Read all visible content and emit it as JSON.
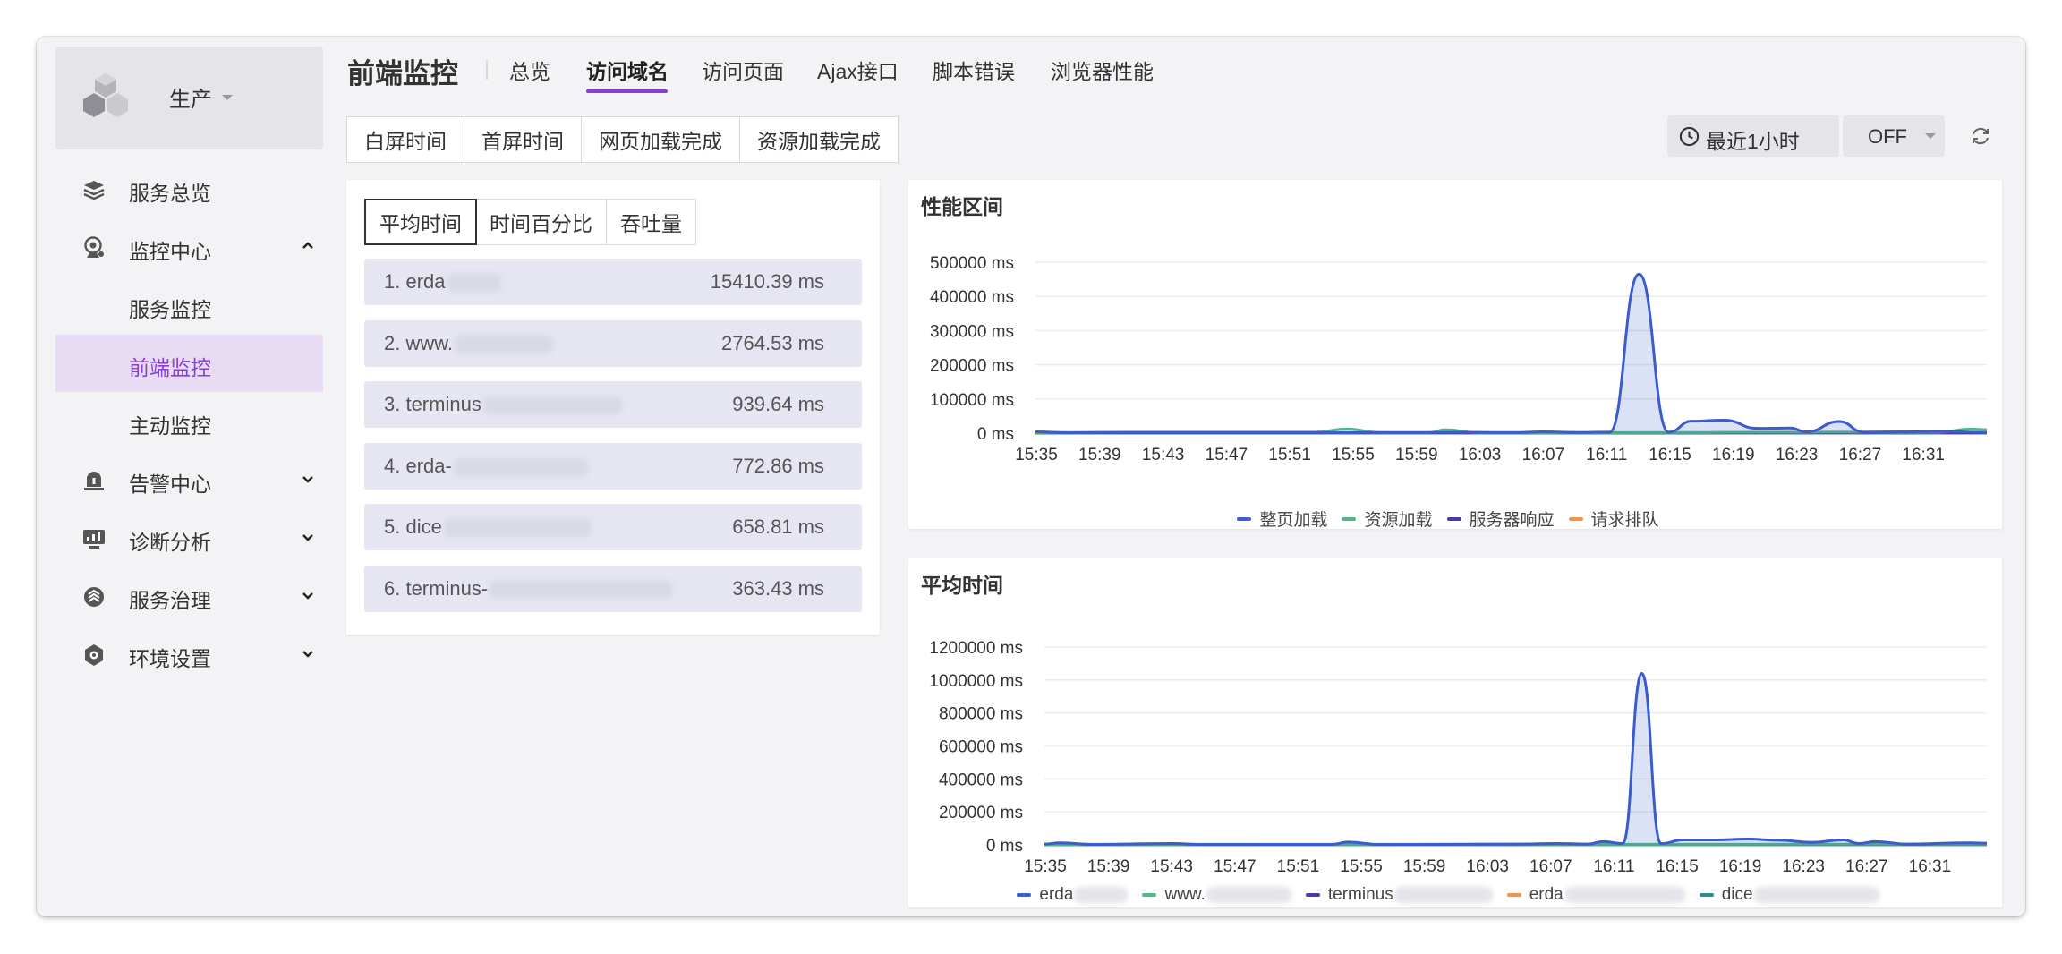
{
  "sidebar": {
    "env_label": "生产",
    "items": [
      {
        "label": "服务总览",
        "icon": "layers-icon"
      },
      {
        "label": "监控中心",
        "icon": "webcam-icon"
      },
      {
        "label": "服务监控"
      },
      {
        "label": "前端监控"
      },
      {
        "label": "主动监控"
      },
      {
        "label": "告警中心",
        "icon": "alarm-icon"
      },
      {
        "label": "诊断分析",
        "icon": "dashboard-icon"
      },
      {
        "label": "服务治理",
        "icon": "governance-icon"
      },
      {
        "label": "环境设置",
        "icon": "settings-icon"
      }
    ]
  },
  "header": {
    "title": "前端监控",
    "tabs": [
      "总览",
      "访问域名",
      "访问页面",
      "Ajax接口",
      "脚本错误",
      "浏览器性能"
    ],
    "active_tab": "访问域名"
  },
  "metric_tabs": [
    "白屏时间",
    "首屏时间",
    "网页加载完成",
    "资源加载完成"
  ],
  "time_range": "最近1小时",
  "refresh_mode": "OFF",
  "ranking": {
    "tabs": [
      "平均时间",
      "时间百分比",
      "吞吐量"
    ],
    "active_tab": "平均时间",
    "rows": [
      {
        "name": "1. erda",
        "value": "15410.39 ms"
      },
      {
        "name": "2. www.",
        "value": "2764.53 ms"
      },
      {
        "name": "3. terminus",
        "value": "939.64 ms"
      },
      {
        "name": "4. erda-",
        "value": "772.86 ms"
      },
      {
        "name": "5. dice",
        "value": "658.81 ms"
      },
      {
        "name": "6. terminus-",
        "value": "363.43 ms"
      }
    ]
  },
  "colors": {
    "accent": "#8a3ed6",
    "blue": "#3a5ccc",
    "green": "#52b788",
    "purple": "#4b3aa0",
    "orange": "#f0944a",
    "teal": "#2f8f8f"
  },
  "chart_data": [
    {
      "type": "area",
      "title": "性能区间",
      "x": [
        "15:35",
        "15:39",
        "15:43",
        "15:47",
        "15:51",
        "15:55",
        "15:59",
        "16:03",
        "16:07",
        "16:11",
        "16:15",
        "16:19",
        "16:23",
        "16:27",
        "16:31"
      ],
      "ytick_labels": [
        "500000 ms",
        "400000 ms",
        "300000 ms",
        "200000 ms",
        "100000 ms",
        "0 ms"
      ],
      "ylim": [
        0,
        500000
      ],
      "series": [
        {
          "name": "整页加载",
          "points": [
            [
              0,
              4000
            ],
            [
              2,
              1000
            ],
            [
              5,
              2000
            ],
            [
              8,
              1500
            ],
            [
              11,
              2000
            ],
            [
              14,
              1500
            ],
            [
              17,
              1500
            ],
            [
              20,
              2000
            ],
            [
              23,
              1500
            ],
            [
              26,
              2500
            ],
            [
              29,
              1500
            ],
            [
              31,
              4000
            ],
            [
              33,
              2000
            ],
            [
              35,
              3000
            ],
            [
              36.8,
              465000
            ],
            [
              38.6,
              3000
            ],
            [
              40,
              35000
            ],
            [
              42,
              38000
            ],
            [
              44,
              14000
            ],
            [
              46,
              15000
            ],
            [
              47,
              4000
            ],
            [
              49,
              34000
            ],
            [
              50.5,
              3000
            ],
            [
              53,
              4000
            ],
            [
              55,
              5000
            ],
            [
              58,
              2000
            ]
          ]
        },
        {
          "name": "资源加载",
          "points": [
            [
              0,
              1500
            ],
            [
              7,
              3000
            ],
            [
              17,
              3000
            ],
            [
              19,
              12000
            ],
            [
              21,
              2000
            ],
            [
              24,
              2000
            ],
            [
              25,
              10000
            ],
            [
              27,
              1500
            ],
            [
              40,
              2000
            ],
            [
              44,
              2500
            ],
            [
              50,
              3000
            ],
            [
              55,
              2500
            ],
            [
              57,
              12000
            ],
            [
              58,
              10000
            ]
          ]
        },
        {
          "name": "服务器响应",
          "points": [
            [
              0,
              300
            ],
            [
              58,
              300
            ]
          ]
        },
        {
          "name": "请求排队",
          "points": [
            [
              0,
              200
            ],
            [
              58,
              200
            ]
          ]
        }
      ]
    },
    {
      "type": "area",
      "title": "平均时间",
      "x": [
        "15:35",
        "15:39",
        "15:43",
        "15:47",
        "15:51",
        "15:55",
        "15:59",
        "16:03",
        "16:07",
        "16:11",
        "16:15",
        "16:19",
        "16:23",
        "16:27",
        "16:31"
      ],
      "ytick_labels": [
        "1200000 ms",
        "1000000 ms",
        "800000 ms",
        "600000 ms",
        "400000 ms",
        "200000 ms",
        "0 ms"
      ],
      "ylim": [
        0,
        1200000
      ],
      "series": [
        {
          "name": "erda",
          "points": [
            [
              0,
              5000
            ],
            [
              1,
              12000
            ],
            [
              3,
              3000
            ],
            [
              8,
              8000
            ],
            [
              10,
              2000
            ],
            [
              18,
              3000
            ],
            [
              19,
              17000
            ],
            [
              21,
              2000
            ],
            [
              30,
              5000
            ],
            [
              32,
              8000
            ],
            [
              34,
              5000
            ],
            [
              35,
              20000
            ],
            [
              36.2,
              8000
            ],
            [
              37.4,
              1040000
            ],
            [
              38.6,
              8000
            ],
            [
              40,
              30000
            ],
            [
              42,
              30000
            ],
            [
              44,
              35000
            ],
            [
              46,
              28000
            ],
            [
              48,
              15000
            ],
            [
              50,
              30000
            ],
            [
              51,
              8000
            ],
            [
              52,
              20000
            ],
            [
              54,
              5000
            ],
            [
              58,
              12000
            ],
            [
              59,
              10000
            ]
          ]
        },
        {
          "name": "www.",
          "points": [
            [
              0,
              3000
            ],
            [
              59,
              4000
            ]
          ]
        },
        {
          "name": "terminus",
          "points": [
            [
              0,
              1500
            ],
            [
              59,
              1500
            ]
          ]
        },
        {
          "name": "erda",
          "points": [
            [
              0,
              1000
            ],
            [
              59,
              1000
            ]
          ]
        },
        {
          "name": "dice",
          "points": [
            [
              0,
              2000
            ],
            [
              59,
              2000
            ]
          ]
        }
      ]
    }
  ],
  "legend2_names": [
    "erda",
    "www.",
    "terminus",
    "erda",
    "dice"
  ]
}
